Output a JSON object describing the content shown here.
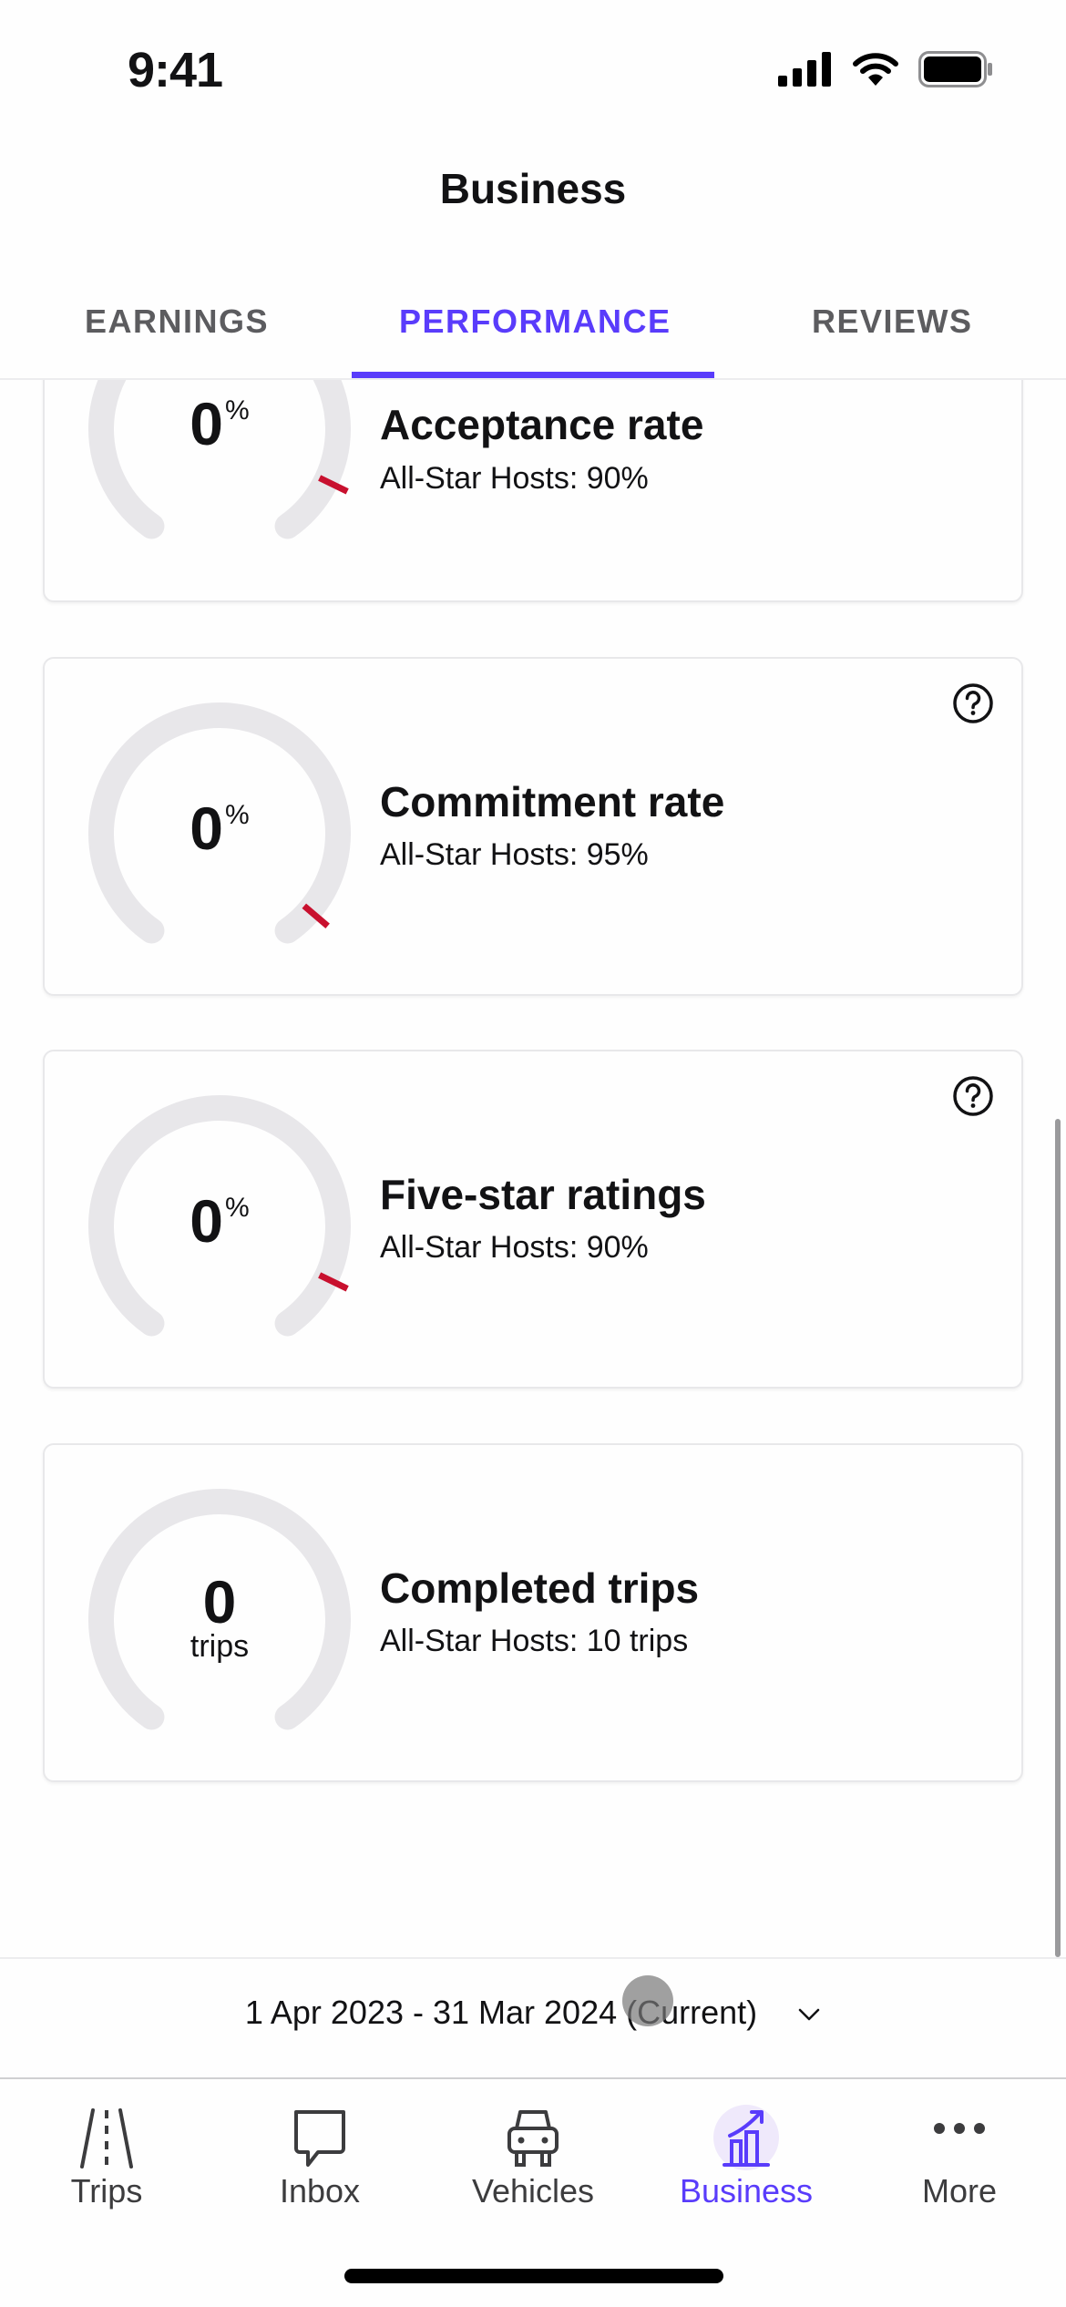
{
  "status_bar": {
    "time": "9:41"
  },
  "header": {
    "title": "Business"
  },
  "tabs": [
    {
      "label": "EARNINGS",
      "active": false
    },
    {
      "label": "PERFORMANCE",
      "active": true
    },
    {
      "label": "REVIEWS",
      "active": false
    }
  ],
  "metrics": [
    {
      "title": "Acceptance rate",
      "value": "0",
      "unit": "%",
      "benchmark": "All-Star Hosts: 90%",
      "progress_percent": 0,
      "target_percent": 90,
      "has_help": false
    },
    {
      "title": "Commitment rate",
      "value": "0",
      "unit": "%",
      "benchmark": "All-Star Hosts: 95%",
      "progress_percent": 0,
      "target_percent": 95,
      "has_help": true
    },
    {
      "title": "Five-star ratings",
      "value": "0",
      "unit": "%",
      "benchmark": "All-Star Hosts: 90%",
      "progress_percent": 0,
      "target_percent": 90,
      "has_help": true
    },
    {
      "title": "Completed trips",
      "value": "0",
      "unit": "trips",
      "benchmark": "All-Star Hosts: 10 trips",
      "progress_percent": 0,
      "target_percent": null,
      "has_help": false
    }
  ],
  "date_range": {
    "label": "1 Apr 2023 - 31 Mar 2024 (Current)",
    "icon": "chevron-down-icon"
  },
  "nav": [
    {
      "label": "Trips",
      "icon": "road-icon",
      "active": false
    },
    {
      "label": "Inbox",
      "icon": "chat-bubble-icon",
      "active": false
    },
    {
      "label": "Vehicles",
      "icon": "car-icon",
      "active": false
    },
    {
      "label": "Business",
      "icon": "chart-growth-icon",
      "active": true
    },
    {
      "label": "More",
      "icon": "more-dots-icon",
      "active": false
    }
  ],
  "colors": {
    "accent": "#593cfb",
    "target_marker": "#c8102e",
    "gauge_track": "#e8e7ea"
  }
}
